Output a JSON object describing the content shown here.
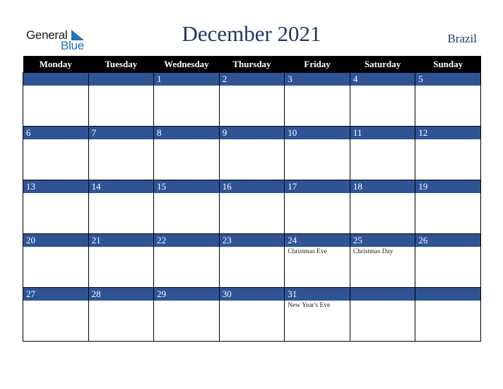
{
  "logo": {
    "line1": "General",
    "line2": "Blue"
  },
  "header": {
    "title": "December 2021",
    "country": "Brazil"
  },
  "colors": {
    "band": "#2f5496",
    "header_bg": "#000000",
    "title": "#1f3864",
    "logo_blue": "#1e73be"
  },
  "weekdays": [
    "Monday",
    "Tuesday",
    "Wednesday",
    "Thursday",
    "Friday",
    "Saturday",
    "Sunday"
  ],
  "weeks": [
    [
      {
        "day": "",
        "holiday": ""
      },
      {
        "day": "",
        "holiday": ""
      },
      {
        "day": "1",
        "holiday": ""
      },
      {
        "day": "2",
        "holiday": ""
      },
      {
        "day": "3",
        "holiday": ""
      },
      {
        "day": "4",
        "holiday": ""
      },
      {
        "day": "5",
        "holiday": ""
      }
    ],
    [
      {
        "day": "6",
        "holiday": ""
      },
      {
        "day": "7",
        "holiday": ""
      },
      {
        "day": "8",
        "holiday": ""
      },
      {
        "day": "9",
        "holiday": ""
      },
      {
        "day": "10",
        "holiday": ""
      },
      {
        "day": "11",
        "holiday": ""
      },
      {
        "day": "12",
        "holiday": ""
      }
    ],
    [
      {
        "day": "13",
        "holiday": ""
      },
      {
        "day": "14",
        "holiday": ""
      },
      {
        "day": "15",
        "holiday": ""
      },
      {
        "day": "16",
        "holiday": ""
      },
      {
        "day": "17",
        "holiday": ""
      },
      {
        "day": "18",
        "holiday": ""
      },
      {
        "day": "19",
        "holiday": ""
      }
    ],
    [
      {
        "day": "20",
        "holiday": ""
      },
      {
        "day": "21",
        "holiday": ""
      },
      {
        "day": "22",
        "holiday": ""
      },
      {
        "day": "23",
        "holiday": ""
      },
      {
        "day": "24",
        "holiday": "Christmas Eve"
      },
      {
        "day": "25",
        "holiday": "Christmas Day"
      },
      {
        "day": "26",
        "holiday": ""
      }
    ],
    [
      {
        "day": "27",
        "holiday": ""
      },
      {
        "day": "28",
        "holiday": ""
      },
      {
        "day": "29",
        "holiday": ""
      },
      {
        "day": "30",
        "holiday": ""
      },
      {
        "day": "31",
        "holiday": "New Year's Eve"
      },
      {
        "day": "",
        "holiday": ""
      },
      {
        "day": "",
        "holiday": ""
      }
    ]
  ]
}
